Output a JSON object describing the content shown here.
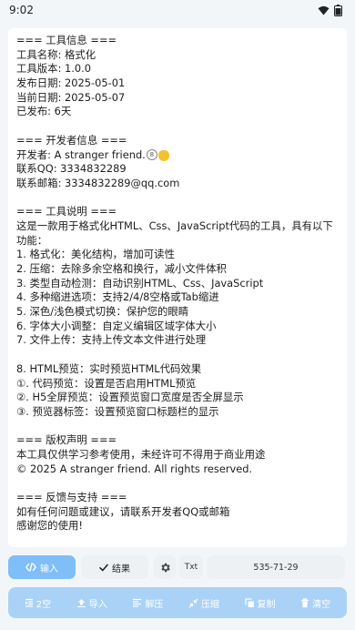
{
  "status": {
    "time": "9:02"
  },
  "content": {
    "sections": {
      "info_title": "=== 工具信息 ===",
      "name": "工具名称: 格式化",
      "version": "工具版本: 1.0.0",
      "release": "发布日期: 2025-05-01",
      "current": "当前日期: 2025-05-07",
      "published": "已发布: 6天",
      "dev_title": "=== 开发者信息 ===",
      "developer": "开发者: A stranger friend.",
      "qq": "联系QQ: 3334832289",
      "email": "联系邮箱: 3334832289@qq.com",
      "desc_title": "=== 工具说明 ===",
      "desc": "这是一款用于格式化HTML、Css、JavaScript代码的工具，具有以下功能：",
      "f1": "1. 格式化：美化结构，增加可读性",
      "f2": "2. 压缩：去除多余空格和换行，减小文件体积",
      "f3": "3. 类型自动检测：自动识别HTML、Css、JavaScript",
      "f4": "4. 多种缩进选项：支持2/4/8空格或Tab缩进",
      "f5": "5. 深色/浅色模式切换：保护您的眼睛",
      "f6": "6. 字体大小调整：自定义编辑区域字体大小",
      "f7": "7. 文件上传：支持上传文本文件进行处理",
      "f8": "8. HTML预览：实时预览HTML代码效果",
      "p1": "①. 代码预览：设置是否启用HTML预览",
      "p2": "②. H5全屏预览：设置预览窗口宽度是否全屏显示",
      "p3": "③. 预览器标签：设置预览窗口标题栏的显示",
      "copy_title": "=== 版权声明 ===",
      "copy1": "本工具仅供学习参考使用，未经许可不得用于商业用途",
      "copy2": "© 2025 A stranger friend. All rights reserved.",
      "fb_title": "=== 反馈与支持 ===",
      "fb1": "如有任何问题或建议，请联系开发者QQ或邮箱",
      "fb2": "感谢您的使用!"
    }
  },
  "toolbar": {
    "input_label": "输入",
    "result_label": "结果",
    "txt_label": "Txt",
    "size_text": "535-71-29"
  },
  "actions": {
    "indent": "2空",
    "import": "导入",
    "decompress": "解压",
    "compress": "压缩",
    "copy": "复制",
    "clear": "清空"
  },
  "colors": {
    "accent": "#7fbef7",
    "toolbar_bg": "#a9d2f6",
    "page_bg": "#f3f6f9"
  }
}
